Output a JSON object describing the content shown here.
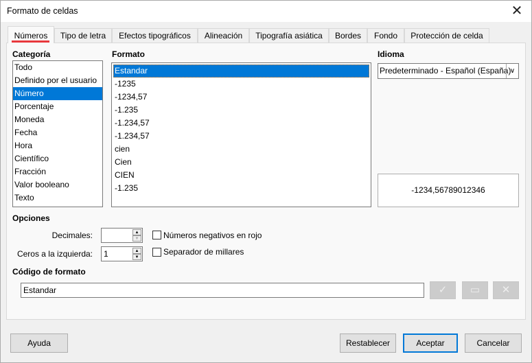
{
  "window": {
    "title": "Formato de celdas",
    "close_icon": "close-icon"
  },
  "tabs": [
    "Números",
    "Tipo de letra",
    "Efectos tipográficos",
    "Alineación",
    "Tipografía asiática",
    "Bordes",
    "Fondo",
    "Protección de celda"
  ],
  "active_tab": "Números",
  "category": {
    "label": "Categoría",
    "items": [
      "Todo",
      "Definido por el usuario",
      "Número",
      "Porcentaje",
      "Moneda",
      "Fecha",
      "Hora",
      "Científico",
      "Fracción",
      "Valor booleano",
      "Texto"
    ],
    "selected": "Número"
  },
  "format": {
    "label": "Formato",
    "items": [
      "Estandar",
      "-1235",
      "-1234,57",
      "-1.235",
      "-1.234,57",
      "-1.234,57",
      "cien",
      "Cien",
      "CIEN",
      "-1.235"
    ],
    "selected": "Estandar"
  },
  "language": {
    "label": "Idioma",
    "value": "Predeterminado - Español (España)"
  },
  "preview": "-1234,56789012346",
  "options": {
    "label": "Opciones",
    "decimals_label": "Decimales:",
    "decimals_value": "",
    "leading_zeros_label": "Ceros a la izquierda:",
    "leading_zeros_value": "1",
    "negative_red_label": "Números negativos en rojo",
    "negative_red_checked": false,
    "thousands_label": "Separador de millares",
    "thousands_checked": false
  },
  "format_code": {
    "label": "Código de formato",
    "value": "Estandar"
  },
  "buttons": {
    "help": "Ayuda",
    "reset": "Restablecer",
    "ok": "Aceptar",
    "cancel": "Cancelar"
  },
  "colors": {
    "accent": "#0078d7",
    "tab_indicator": "#e8383d"
  }
}
